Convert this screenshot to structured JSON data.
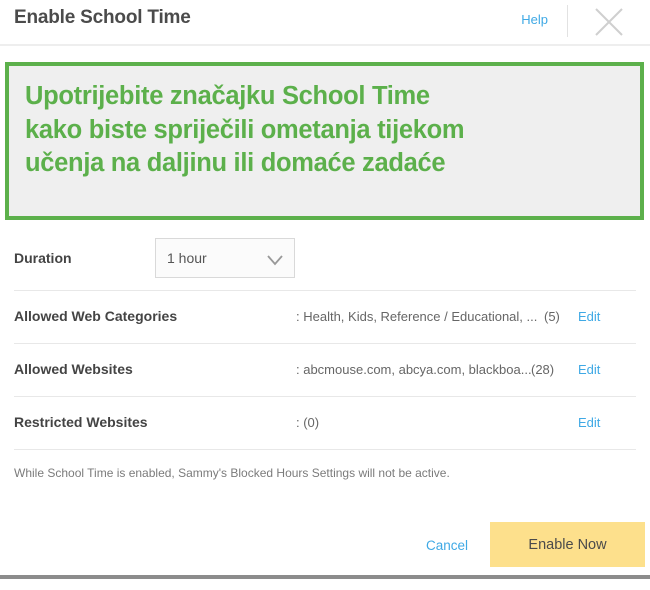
{
  "header": {
    "title": "Enable School Time",
    "help_label": "Help",
    "close_icon": "close-icon"
  },
  "callout": {
    "text": "Upotrijebite značajku School Time\nkako biste spriječili ometanja tijekom\nučenja na daljinu ili domaće zadaće",
    "border_color": "#5cb04b",
    "background_color": "#efefef",
    "text_color": "#5cb04b"
  },
  "duration": {
    "label": "Duration",
    "selected": "1 hour",
    "chevron_icon": "chevron-down-icon"
  },
  "rows": [
    {
      "label": "Allowed Web Categories",
      "value": ": Health, Kids, Reference / Educational, ...",
      "count": "(5)",
      "edit_label": "Edit"
    },
    {
      "label": "Allowed Websites",
      "value": ": abcmouse.com, abcya.com, blackboa...",
      "count": "(28)",
      "edit_label": "Edit"
    },
    {
      "label": "Restricted Websites",
      "value": ": (0)",
      "count": "",
      "edit_label": "Edit"
    }
  ],
  "footnote": "While School Time is enabled, Sammy's Blocked Hours Settings will not be active.",
  "footer": {
    "cancel_label": "Cancel",
    "enable_label": "Enable Now",
    "enable_color": "#fde08c",
    "link_color": "#3fa9e5"
  }
}
